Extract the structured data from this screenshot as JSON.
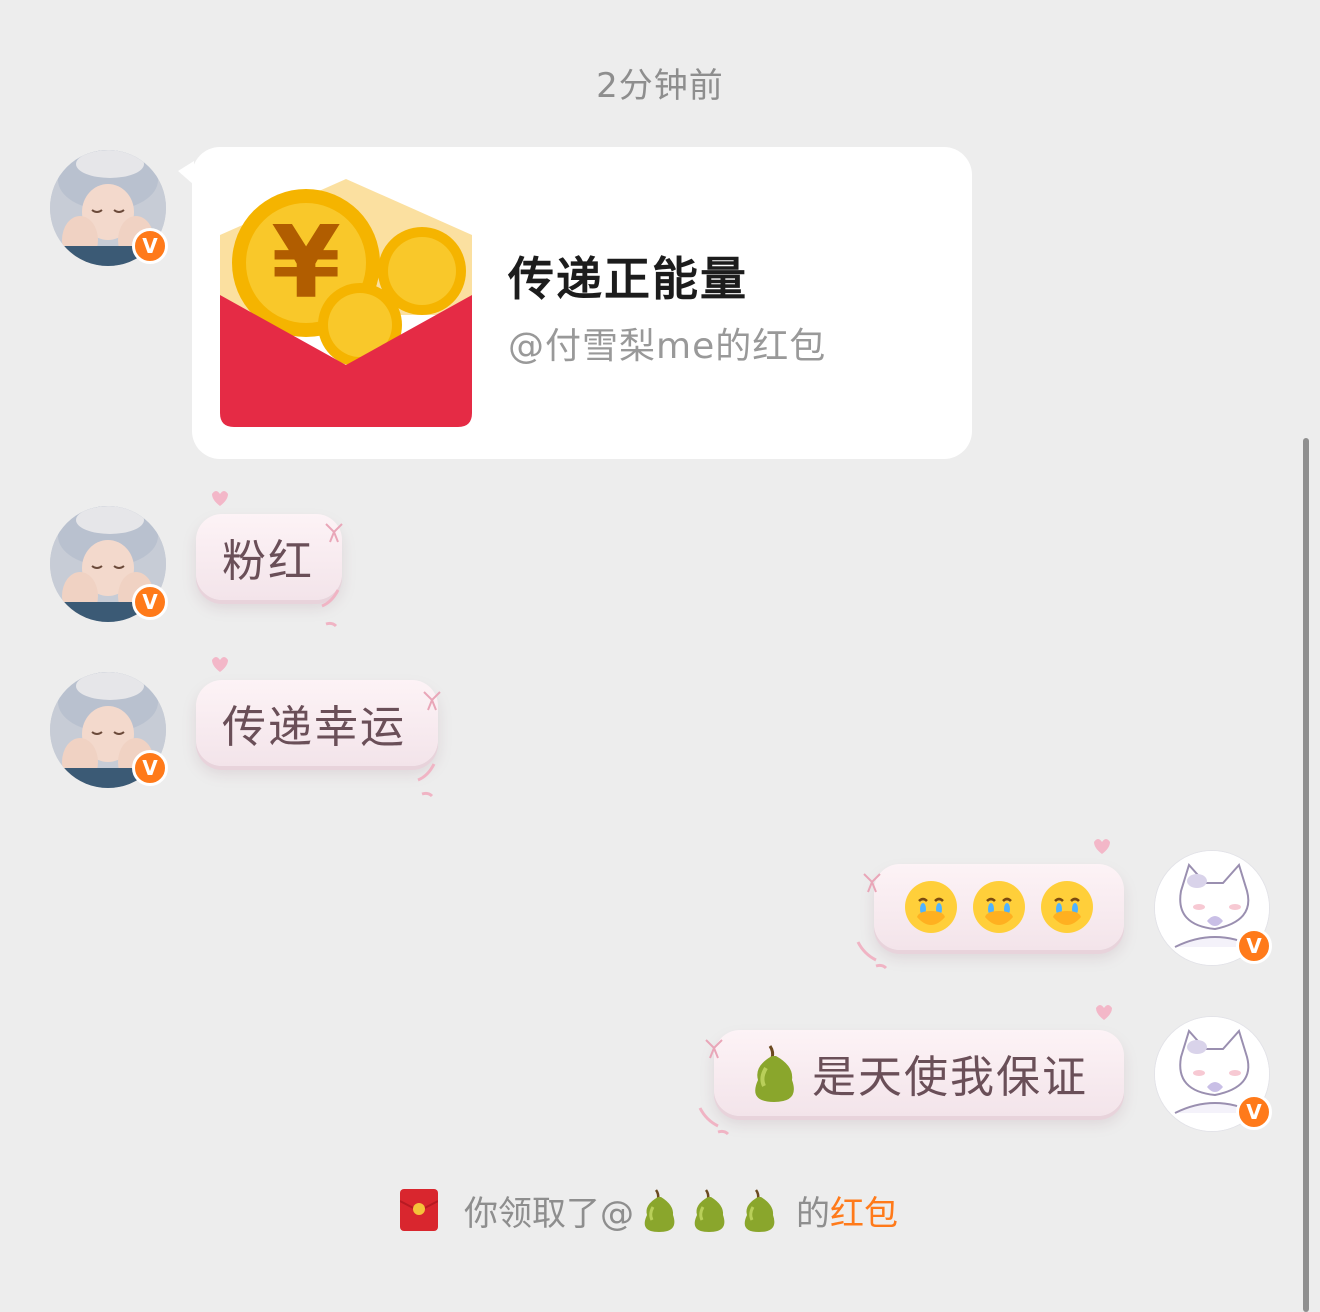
{
  "timestamp": "2分钟前",
  "red_packet_card": {
    "title": "传递正能量",
    "subtitle": "@付雪梨me的红包",
    "icon": "red-packet-coins-icon"
  },
  "messages": [
    {
      "side": "left",
      "text": "粉红"
    },
    {
      "side": "left",
      "text": "传递幸运"
    },
    {
      "side": "right",
      "text": "",
      "emojis": [
        "crying-face-emoji",
        "crying-face-emoji",
        "crying-face-emoji"
      ]
    },
    {
      "side": "right",
      "text": "是天使我保证",
      "emoji": "pear-emoji"
    }
  ],
  "avatars": {
    "other_user": {
      "badge": "V",
      "icon": "girl-in-fur-hat-avatar"
    },
    "self_user": {
      "badge": "V",
      "icon": "white-cat-avatar"
    }
  },
  "notice": {
    "prefix": "你领取了@",
    "suffix": "的",
    "link": "红包",
    "icon": "red-packet-small-icon",
    "emojis": [
      "pear-emoji",
      "pear-emoji",
      "pear-emoji"
    ]
  },
  "colors": {
    "background": "#ededed",
    "bubble_pink": "#fdf3f6",
    "badge_orange": "#ff7a1a",
    "link_orange": "#ff7a1a"
  }
}
